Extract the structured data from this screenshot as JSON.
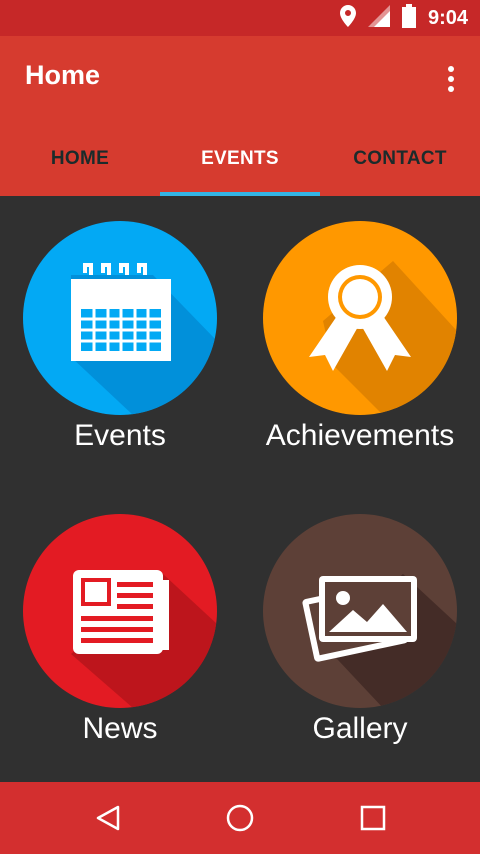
{
  "status_bar": {
    "time": "9:04",
    "icons": [
      "location-icon",
      "signal-icon",
      "battery-icon"
    ]
  },
  "app_bar": {
    "title": "Home",
    "menu_icon": "more-vert-icon"
  },
  "tabs": [
    {
      "label": "HOME",
      "active": false
    },
    {
      "label": "EVENTS",
      "active": true
    },
    {
      "label": "CONTACT",
      "active": false
    }
  ],
  "tiles": [
    {
      "label": "Events",
      "icon": "calendar-icon",
      "color": "#03a9f4"
    },
    {
      "label": "Achievements",
      "icon": "award-ribbon-icon",
      "color": "#ff9800"
    },
    {
      "label": "News",
      "icon": "newspaper-icon",
      "color": "#e31b23"
    },
    {
      "label": "Gallery",
      "icon": "photos-icon",
      "color": "#5d4037"
    }
  ],
  "nav_bar": {
    "icons": [
      "back-icon",
      "home-icon",
      "recents-icon"
    ]
  },
  "colors": {
    "status_bar": "#c62828",
    "app_bar": "#d63b2f",
    "tab_indicator": "#33b5e5",
    "background": "#303030",
    "nav_bar": "#d32f2f"
  }
}
